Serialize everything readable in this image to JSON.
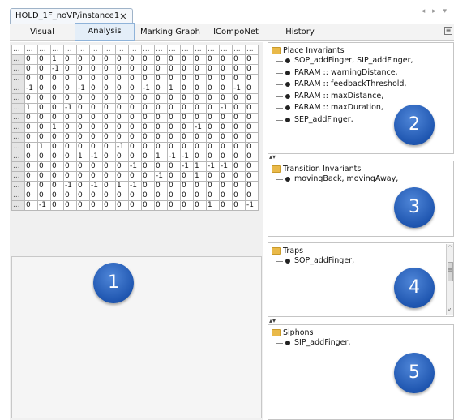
{
  "tab": {
    "title": "HOLD_1F_noVP/instance1",
    "close": "×"
  },
  "nav_arrows": "◂ ▸ ▾",
  "subtabs": [
    "Visual",
    "Analysis",
    "Marking Graph",
    "ICompoNet",
    "History"
  ],
  "active_subtab": "Analysis",
  "menu_glyph": "≡",
  "matrix": {
    "header": [
      "...",
      "...",
      "...",
      "...",
      "...",
      "...",
      "...",
      "...",
      "...",
      "...",
      "...",
      "...",
      "...",
      "...",
      "...",
      "...",
      "...",
      "...",
      "..."
    ],
    "rows": [
      [
        "...",
        "0",
        "0",
        "1",
        "0",
        "0",
        "0",
        "0",
        "0",
        "0",
        "0",
        "0",
        "0",
        "0",
        "0",
        "0",
        "0",
        "0",
        "0"
      ],
      [
        "...",
        "0",
        "0",
        "-1",
        "0",
        "0",
        "0",
        "0",
        "0",
        "0",
        "0",
        "0",
        "0",
        "0",
        "0",
        "0",
        "0",
        "0",
        "0"
      ],
      [
        "...",
        "0",
        "0",
        "0",
        "0",
        "0",
        "0",
        "0",
        "0",
        "0",
        "0",
        "0",
        "0",
        "0",
        "0",
        "0",
        "0",
        "0",
        "0"
      ],
      [
        "...",
        "-1",
        "0",
        "0",
        "0",
        "-1",
        "0",
        "0",
        "0",
        "0",
        "-1",
        "0",
        "1",
        "0",
        "0",
        "0",
        "0",
        "-1",
        "0"
      ],
      [
        "...",
        "0",
        "0",
        "0",
        "0",
        "0",
        "0",
        "0",
        "0",
        "0",
        "0",
        "0",
        "0",
        "0",
        "0",
        "0",
        "0",
        "0",
        "0"
      ],
      [
        "...",
        "1",
        "0",
        "0",
        "-1",
        "0",
        "0",
        "0",
        "0",
        "0",
        "0",
        "0",
        "0",
        "0",
        "0",
        "0",
        "-1",
        "0",
        "0"
      ],
      [
        "...",
        "0",
        "0",
        "0",
        "0",
        "0",
        "0",
        "0",
        "0",
        "0",
        "0",
        "0",
        "0",
        "0",
        "0",
        "0",
        "0",
        "0",
        "0"
      ],
      [
        "...",
        "0",
        "0",
        "1",
        "0",
        "0",
        "0",
        "0",
        "0",
        "0",
        "0",
        "0",
        "0",
        "0",
        "-1",
        "0",
        "0",
        "0",
        "0"
      ],
      [
        "...",
        "0",
        "0",
        "0",
        "0",
        "0",
        "0",
        "0",
        "0",
        "0",
        "0",
        "0",
        "0",
        "0",
        "0",
        "0",
        "0",
        "0",
        "0"
      ],
      [
        "...",
        "0",
        "1",
        "0",
        "0",
        "0",
        "0",
        "0",
        "-1",
        "0",
        "0",
        "0",
        "0",
        "0",
        "0",
        "0",
        "0",
        "0",
        "0"
      ],
      [
        "...",
        "0",
        "0",
        "0",
        "0",
        "1",
        "-1",
        "0",
        "0",
        "0",
        "0",
        "1",
        "-1",
        "-1",
        "0",
        "0",
        "0",
        "0",
        "0"
      ],
      [
        "...",
        "0",
        "0",
        "0",
        "0",
        "0",
        "0",
        "0",
        "0",
        "-1",
        "0",
        "0",
        "0",
        "-1",
        "1",
        "-1",
        "-1",
        "0",
        "0"
      ],
      [
        "...",
        "0",
        "0",
        "0",
        "0",
        "0",
        "0",
        "0",
        "0",
        "0",
        "0",
        "-1",
        "0",
        "0",
        "1",
        "0",
        "0",
        "0",
        "0"
      ],
      [
        "...",
        "0",
        "0",
        "0",
        "-1",
        "0",
        "-1",
        "0",
        "1",
        "-1",
        "0",
        "0",
        "0",
        "0",
        "0",
        "0",
        "0",
        "0",
        "0"
      ],
      [
        "...",
        "0",
        "0",
        "0",
        "0",
        "0",
        "0",
        "0",
        "0",
        "0",
        "0",
        "0",
        "0",
        "0",
        "0",
        "0",
        "0",
        "0",
        "0"
      ],
      [
        "...",
        "0",
        "-1",
        "0",
        "0",
        "0",
        "0",
        "0",
        "0",
        "0",
        "0",
        "0",
        "0",
        "0",
        "0",
        "1",
        "0",
        "0",
        "-1"
      ]
    ]
  },
  "panels": {
    "place": {
      "title": "Place Invariants",
      "items": [
        "SOP_addFinger, SIP_addFinger,",
        "PARAM :: warningDistance,",
        "PARAM :: feedbackThreshold,",
        "PARAM :: maxDistance,",
        "PARAM :: maxDuration,",
        "SEP_addFinger,"
      ],
      "badge": "2"
    },
    "transition": {
      "title": "Transition Invariants",
      "items": [
        "movingBack, movingAway,"
      ],
      "badge": "3"
    },
    "traps": {
      "title": "Traps",
      "items": [
        "SOP_addFinger,"
      ],
      "badge": "4"
    },
    "siphons": {
      "title": "Siphons",
      "items": [
        "SIP_addFinger,"
      ],
      "badge": "5"
    }
  },
  "matrix_badge": "1",
  "splitter_glyph": "▴▾",
  "scroll": {
    "up": "^",
    "down": "v",
    "grip": "≡"
  }
}
